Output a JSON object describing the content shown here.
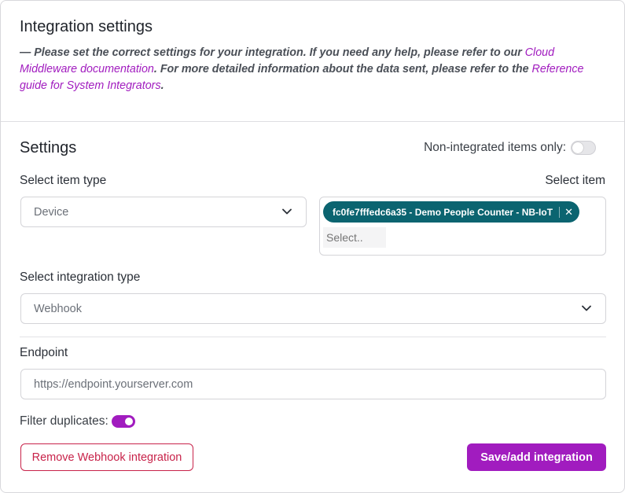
{
  "header": {
    "title": "Integration settings",
    "intro_prefix": "— Please set the correct settings for your integration. If you need any help, please refer to our ",
    "link_cloud": "Cloud Middleware documentation",
    "intro_middle": ". For more detailed information about the data sent, please refer to the ",
    "link_reference": "Reference guide for System Integrators",
    "intro_suffix": "."
  },
  "settings": {
    "title": "Settings",
    "non_integrated_label": "Non-integrated items only:",
    "non_integrated_enabled": false
  },
  "item_type": {
    "label": "Select item type",
    "value": "Device"
  },
  "item": {
    "label": "Select item",
    "selected_chip": "fc0fe7fffedc6a35 - Demo People Counter - NB-IoT",
    "remove_glyph": "✕",
    "placeholder": "Select.."
  },
  "integration_type": {
    "label": "Select integration type",
    "value": "Webhook"
  },
  "endpoint": {
    "label": "Endpoint",
    "placeholder": "https://endpoint.yourserver.com"
  },
  "filter_duplicates": {
    "label": "Filter duplicates:",
    "enabled": true
  },
  "actions": {
    "remove_label": "Remove Webhook integration",
    "save_label": "Save/add integration"
  },
  "colors": {
    "accent": "#a11cbf",
    "chip": "#0b6470",
    "danger": "#c8234a"
  }
}
